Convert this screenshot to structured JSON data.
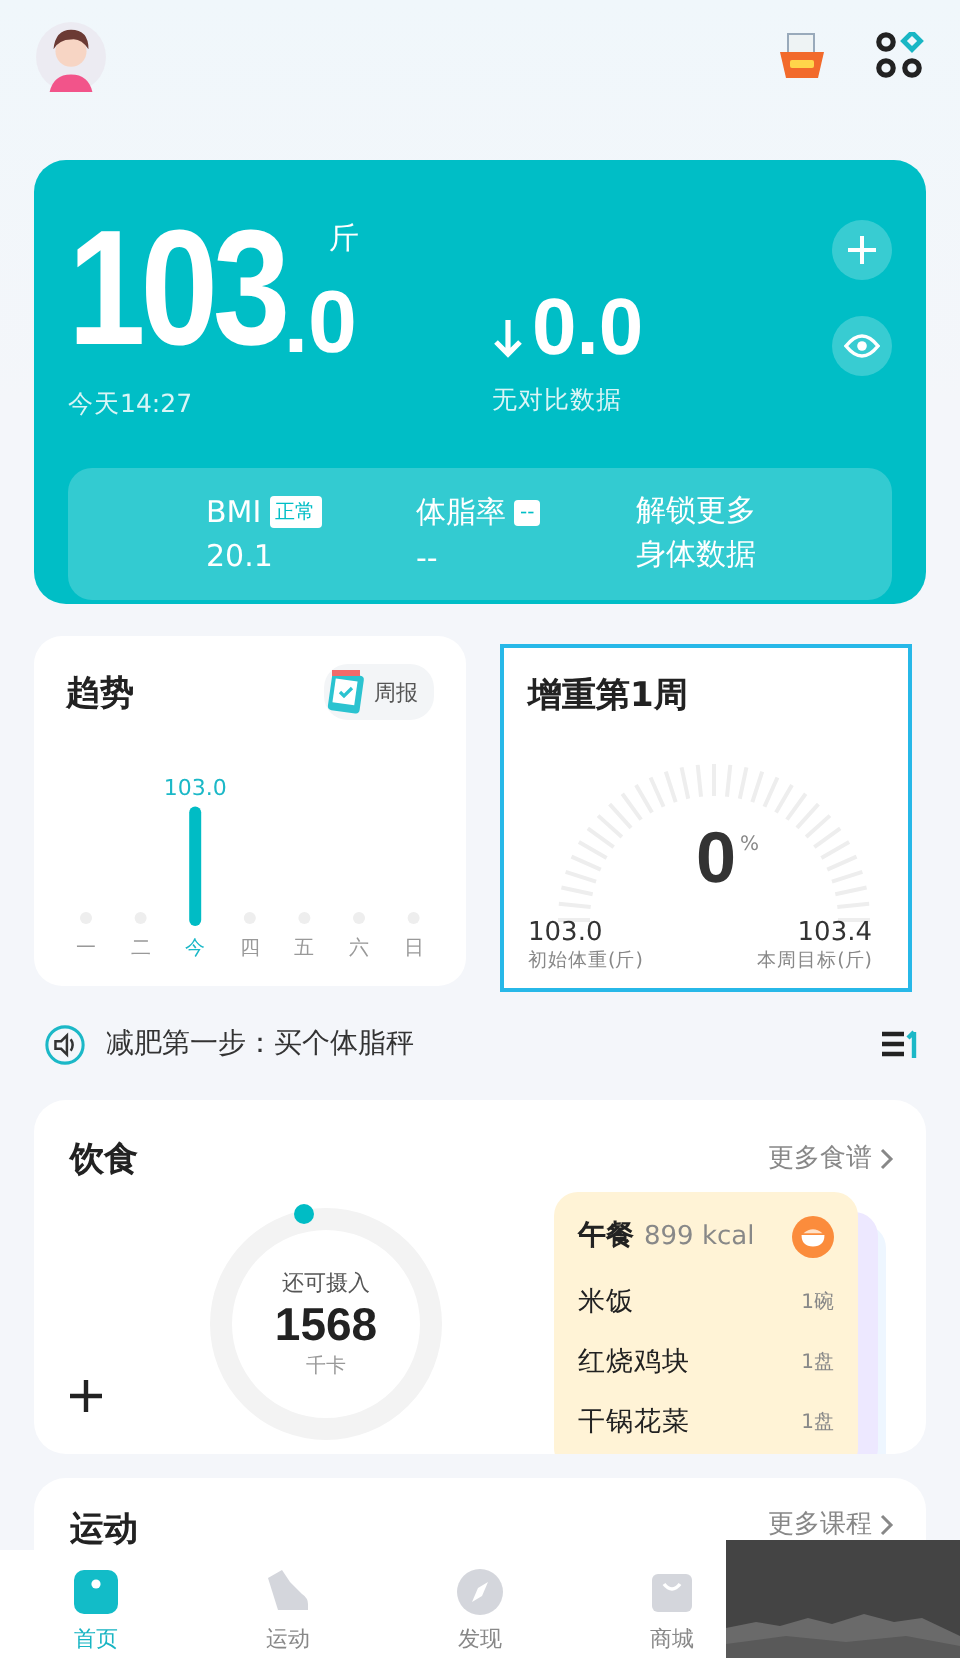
{
  "weight": {
    "value": "103",
    "decimal": ".0",
    "unit": "斤",
    "time": "今天14:27",
    "change": "0.0",
    "change_note": "无对比数据",
    "metrics": [
      {
        "label": "BMI",
        "badge": "正常",
        "value": "20.1"
      },
      {
        "label": "体脂率",
        "badge": "--",
        "value": "--"
      }
    ],
    "unlock": "解锁更多身体数据"
  },
  "trend": {
    "title": "趋势",
    "report": "周报",
    "chart_data": {
      "type": "bar",
      "categories": [
        "一",
        "二",
        "今",
        "四",
        "五",
        "六",
        "日"
      ],
      "values": [
        null,
        null,
        103.0,
        null,
        null,
        null,
        null
      ],
      "value_labels": [
        null,
        null,
        "103.0",
        null,
        null,
        null,
        null
      ]
    }
  },
  "goal": {
    "title": "增重第1周",
    "percent": "0",
    "percent_unit": "%",
    "start": "103.0",
    "start_label": "初始体重(斤)",
    "target": "103.4",
    "target_label": "本周目标(斤)"
  },
  "tip": "减肥第一步：买个体脂秤",
  "diet": {
    "title": "饮食",
    "more": "更多食谱",
    "remaining_label": "还可摄入",
    "remaining": "1568",
    "remaining_unit": "千卡",
    "meal": {
      "name": "午餐",
      "kcal": "899 kcal",
      "items": [
        {
          "name": "米饭",
          "qty": "1碗"
        },
        {
          "name": "红烧鸡块",
          "qty": "1盘"
        },
        {
          "name": "干锅花菜",
          "qty": "1盘"
        }
      ]
    }
  },
  "sport": {
    "title": "运动",
    "more": "更多课程"
  },
  "tabs": [
    {
      "label": "首页",
      "selected": true,
      "kind": "home"
    },
    {
      "label": "运动",
      "selected": false,
      "kind": "shoe"
    },
    {
      "label": "发现",
      "selected": false,
      "kind": "compass"
    },
    {
      "label": "商城",
      "selected": false,
      "kind": "bag"
    }
  ]
}
